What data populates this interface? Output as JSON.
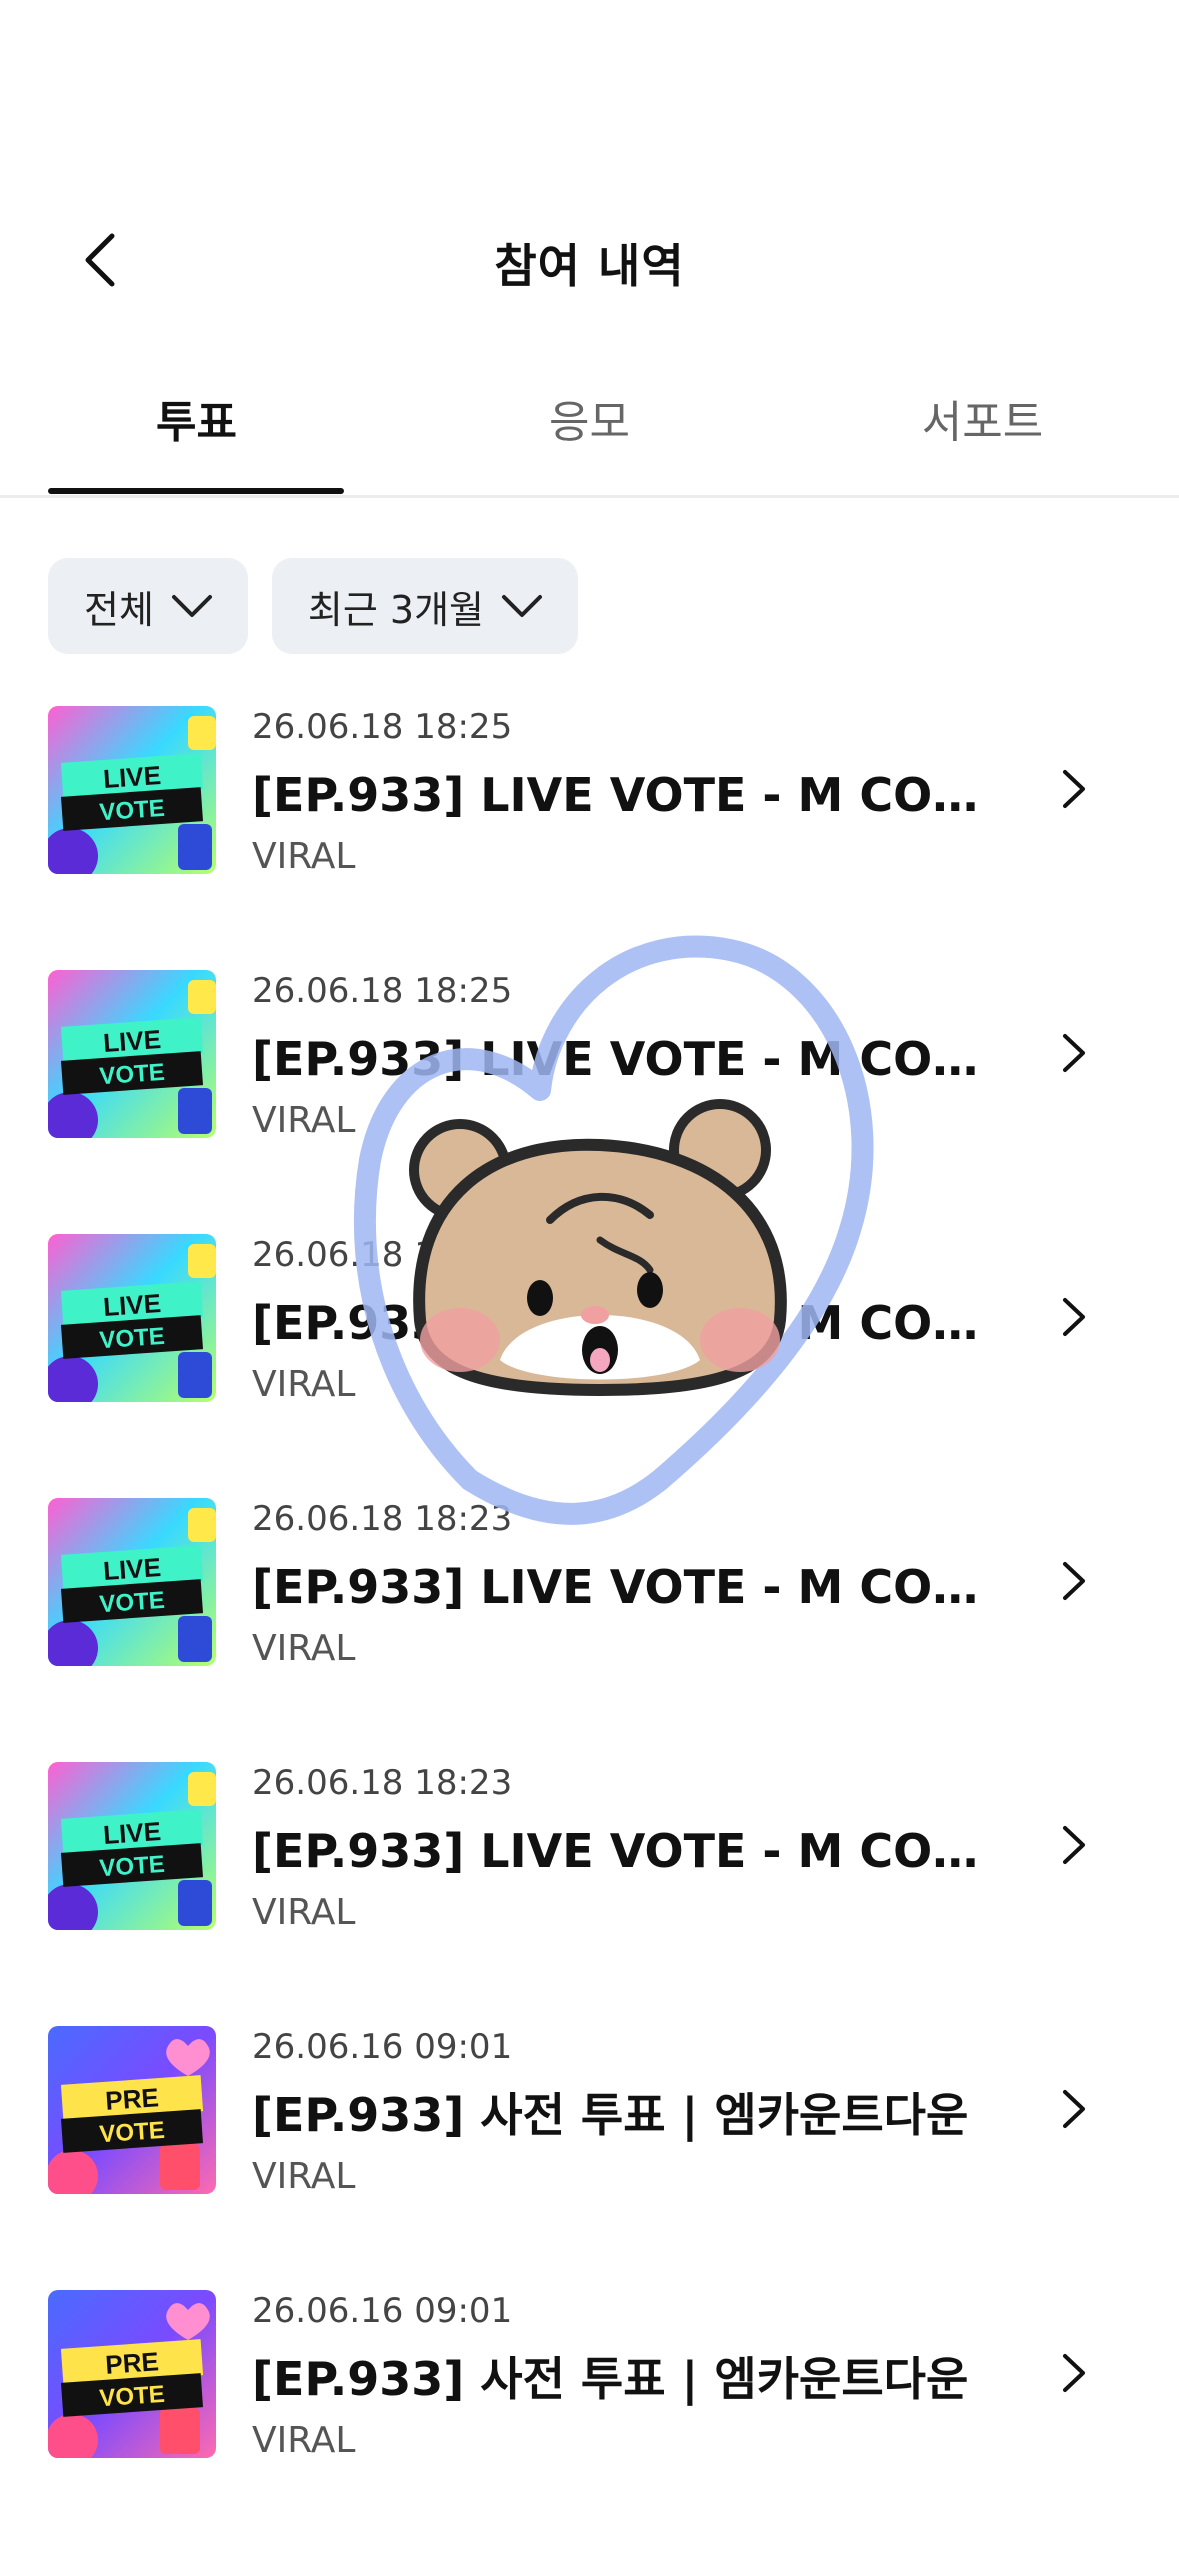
{
  "header": {
    "title": "참여 내역"
  },
  "tabs": [
    {
      "label": "투표",
      "active": true
    },
    {
      "label": "응모",
      "active": false
    },
    {
      "label": "서포트",
      "active": false
    }
  ],
  "filters": {
    "category": "전체",
    "period": "최근 3개월"
  },
  "items": [
    {
      "date": "26.06.18 18:25",
      "title": "[EP.933] LIVE VOTE - M COUNT...",
      "sub": "VIRAL",
      "thumb_top": "LIVE",
      "thumb_bottom": "VOTE"
    },
    {
      "date": "26.06.18 18:25",
      "title": "[EP.933] LIVE VOTE - M COUNT...",
      "sub": "VIRAL",
      "thumb_top": "LIVE",
      "thumb_bottom": "VOTE"
    },
    {
      "date": "26.06.18 18:24",
      "title": "[EP.933] LIVE VOTE - M COUNT...",
      "sub": "VIRAL",
      "thumb_top": "LIVE",
      "thumb_bottom": "VOTE"
    },
    {
      "date": "26.06.18 18:23",
      "title": "[EP.933] LIVE VOTE - M COUNT...",
      "sub": "VIRAL",
      "thumb_top": "LIVE",
      "thumb_bottom": "VOTE"
    },
    {
      "date": "26.06.18 18:23",
      "title": "[EP.933] LIVE VOTE - M COUNT...",
      "sub": "VIRAL",
      "thumb_top": "LIVE",
      "thumb_bottom": "VOTE"
    },
    {
      "date": "26.06.16 09:01",
      "title": "[EP.933] 사전 투표 | 엠카운트다운",
      "sub": "VIRAL",
      "thumb_top": "PRE",
      "thumb_bottom": "VOTE"
    },
    {
      "date": "26.06.16 09:01",
      "title": "[EP.933] 사전 투표 | 엠카운트다운",
      "sub": "VIRAL",
      "thumb_top": "PRE",
      "thumb_bottom": "VOTE"
    }
  ],
  "colors": {
    "live_bg_top": "#ff5fd2",
    "live_bg_bottom": "#4ef2c9",
    "pre_bg_top": "#4a6bff",
    "pre_bg_bottom": "#ffe34a",
    "heart_stroke": "#9fb6f2",
    "hamster_fur": "#d9b897"
  },
  "icons": {
    "back": "chevron-left-icon",
    "row_arrow": "chevron-right-icon",
    "dropdown": "chevron-down-icon",
    "sticker": "hamster-heart-sticker"
  }
}
